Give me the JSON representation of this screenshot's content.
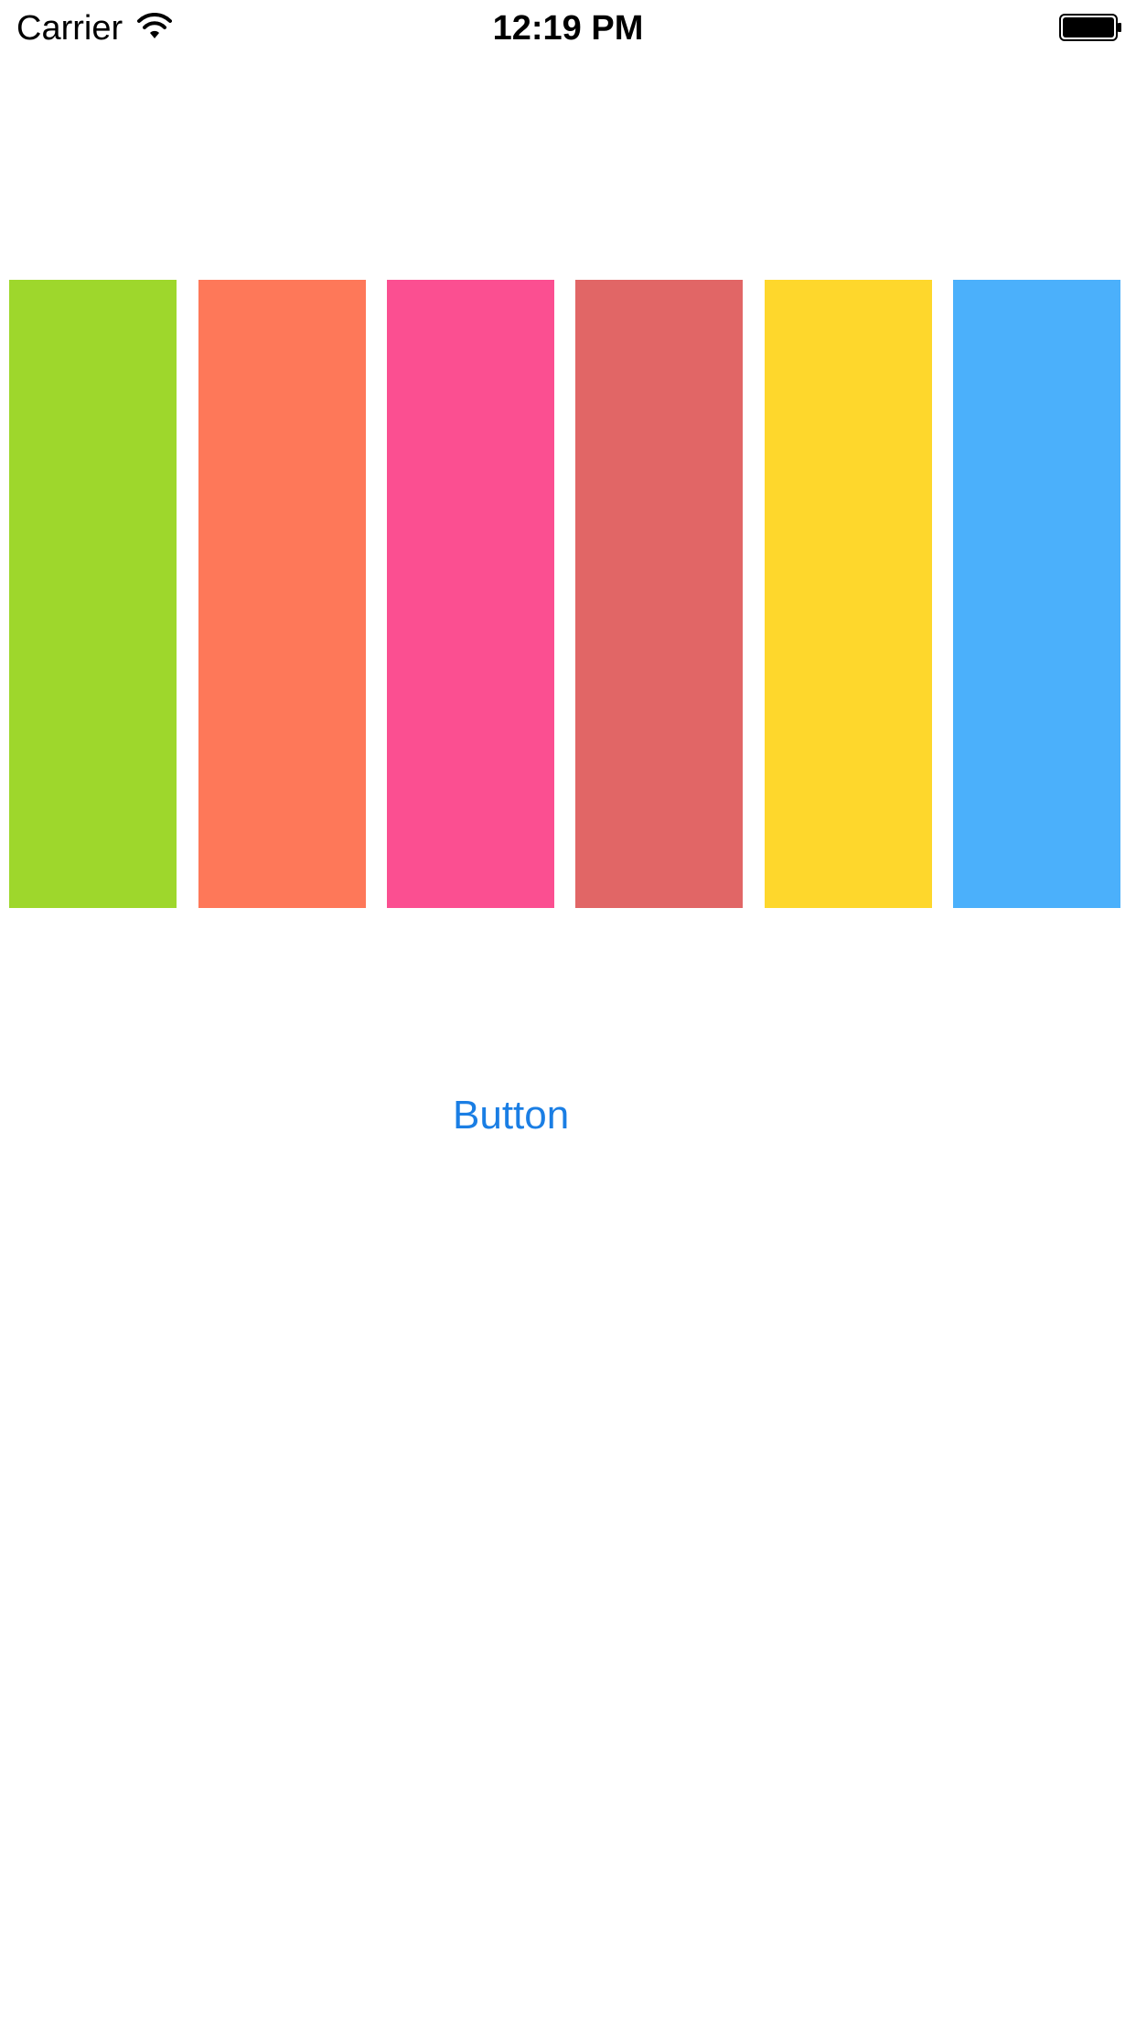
{
  "status_bar": {
    "carrier": "Carrier",
    "time": "12:19 PM",
    "wifi_icon": "wifi-icon",
    "battery_icon": "battery-icon"
  },
  "color_bars": [
    {
      "color": "#9ed72c"
    },
    {
      "color": "#fe7859"
    },
    {
      "color": "#fb4f91"
    },
    {
      "color": "#e16666"
    },
    {
      "color": "#fed72c"
    },
    {
      "color": "#4bb0fb"
    }
  ],
  "main": {
    "button_label": "Button",
    "button_color": "#1a7ee4"
  }
}
